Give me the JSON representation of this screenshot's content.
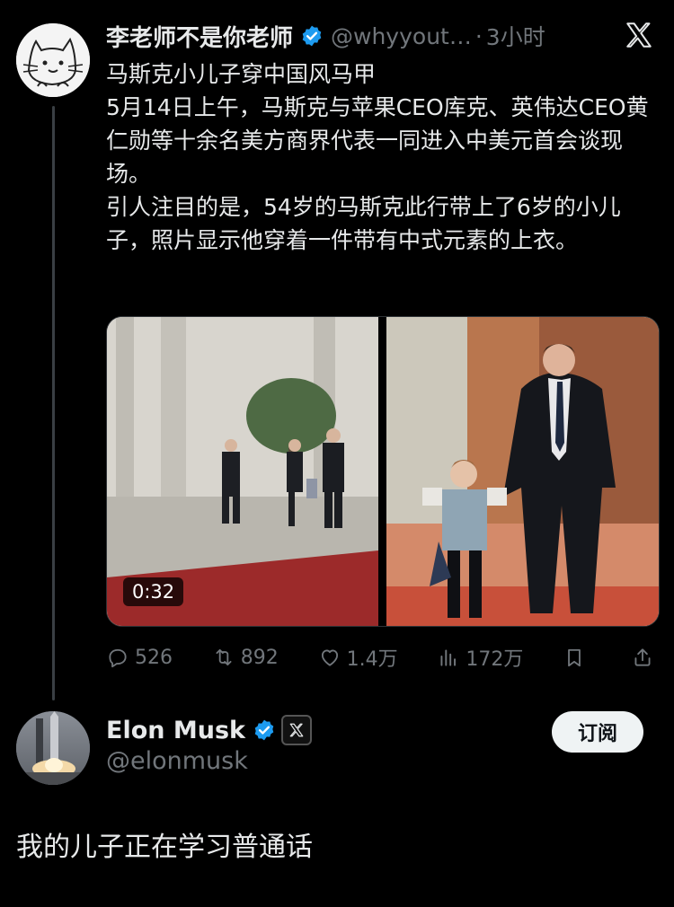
{
  "tweet": {
    "author_name": "李老师不是你老师",
    "handle": "@whyyout…",
    "separator": "·",
    "time": "3小时",
    "lines": [
      "马斯克小儿子穿中国风马甲",
      "5月14日上午，马斯克与苹果CEO库克、英伟达CEO黄仁勋等十余名美方商界代表一同进入中美元首会谈现场。",
      "引人注目的是，54岁的马斯克此行带上了6岁的小儿子，照片显示他穿着一件带有中式元素的上衣。"
    ],
    "video_duration": "0:32",
    "stats": {
      "replies": "526",
      "retweets": "892",
      "likes": "1.4万",
      "views": "172万"
    }
  },
  "reply": {
    "author_name": "Elon Musk",
    "handle": "@elonmusk",
    "subscribe_label": "订阅",
    "text": "我的儿子正在学习普通话"
  },
  "colors": {
    "background": "#000000",
    "text": "#e7e9ea",
    "muted": "#71767b",
    "verified": "#1d9bf0"
  }
}
